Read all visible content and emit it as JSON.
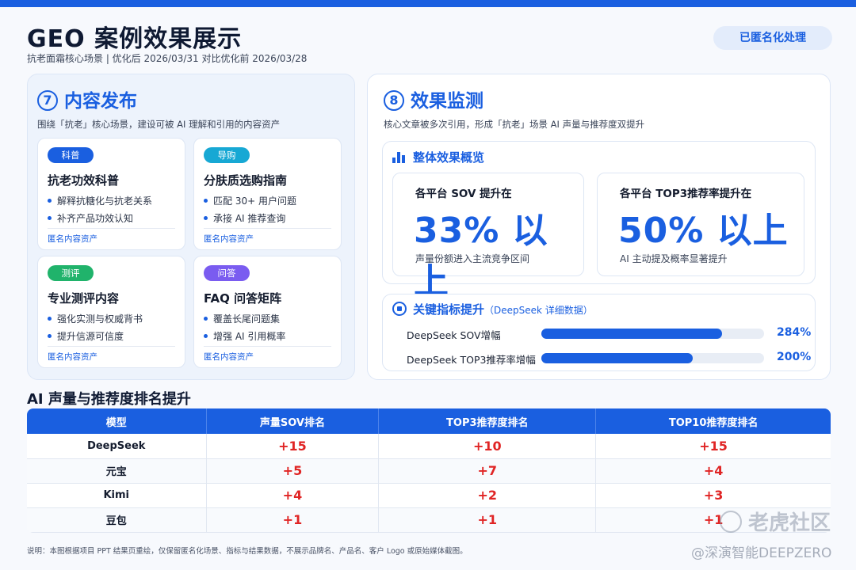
{
  "header": {
    "title": "GEO 案例效果展示",
    "subtitle": "抗老面霜核心场景 | 优化后 2026/03/31 对比优化前 2026/03/28",
    "badge": "已匿名化处理"
  },
  "left": {
    "num": "7",
    "title": "内容发布",
    "desc": "围绕「抗老」核心场景，建设可被 AI 理解和引用的内容资产",
    "cards": [
      {
        "tag": "科普",
        "tag_color": "#1a5fe0",
        "title": "抗老功效科普",
        "bullets": [
          "解释抗糖化与抗老关系",
          "补齐产品功效认知"
        ],
        "foot": "匿名内容资产"
      },
      {
        "tag": "导购",
        "tag_color": "#17a8d4",
        "title": "分肤质选购指南",
        "bullets": [
          "匹配 30+ 用户问题",
          "承接 AI 推荐查询"
        ],
        "foot": "匿名内容资产"
      },
      {
        "tag": "测评",
        "tag_color": "#20b36b",
        "title": "专业测评内容",
        "bullets": [
          "强化实测与权威背书",
          "提升信源可信度"
        ],
        "foot": "匿名内容资产"
      },
      {
        "tag": "问答",
        "tag_color": "#7a5cf0",
        "title": "FAQ 问答矩阵",
        "bullets": [
          "覆盖长尾问题集",
          "增强 AI 引用概率"
        ],
        "foot": "匿名内容资产"
      }
    ]
  },
  "right": {
    "num": "8",
    "title": "效果监测",
    "desc": "核心文章被多次引用，形成「抗老」场景 AI 声量与推荐度双提升",
    "overview": {
      "title": "整体效果概览",
      "metrics": [
        {
          "label": "各平台 SOV 提升在",
          "value": "33% 以上",
          "note": "声量份额进入主流竞争区间"
        },
        {
          "label": "各平台 TOP3推荐率提升在",
          "value": "50% 以上",
          "note": "AI 主动提及概率显著提升"
        }
      ]
    },
    "key": {
      "title": "关键指标提升",
      "title_paren": "（DeepSeek 详细数据）",
      "bars": [
        {
          "label": "DeepSeek SOV增幅",
          "value": "284%",
          "fill": 0.81
        },
        {
          "label": "DeepSeek TOP3推荐率增幅",
          "value": "200%",
          "fill": 0.68
        }
      ]
    }
  },
  "table": {
    "title": "AI 声量与推荐度排名提升",
    "headers": [
      "模型",
      "声量SOV排名",
      "TOP3推荐度排名",
      "TOP10推荐度排名"
    ],
    "rows": [
      [
        "DeepSeek",
        "+15",
        "+10",
        "+15"
      ],
      [
        "元宝",
        "+5",
        "+7",
        "+4"
      ],
      [
        "Kimi",
        "+4",
        "+2",
        "+3"
      ],
      [
        "豆包",
        "+1",
        "+1",
        "+1"
      ]
    ]
  },
  "footnote": "说明：本图根据项目 PPT 结果页重绘，仅保留匿名化场景、指标与结果数据，不展示品牌名、产品名、客户 Logo 或原始媒体截图。",
  "watermark": {
    "community": "老虎社区",
    "author": "@深演智能DEEPZERO"
  }
}
